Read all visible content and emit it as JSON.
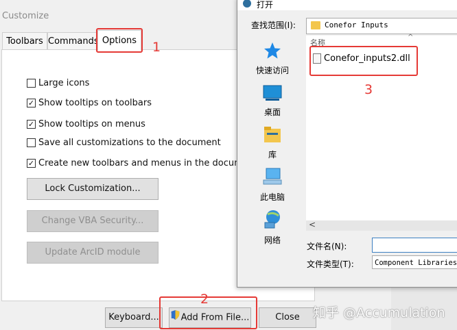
{
  "customize": {
    "title": "Customize",
    "tabs": [
      "Toolbars",
      "Commands",
      "Options"
    ],
    "checkboxes": [
      {
        "label": "Large icons",
        "checked": false
      },
      {
        "label": "Show tooltips on toolbars",
        "checked": true
      },
      {
        "label": "Show tooltips on menus",
        "checked": true
      },
      {
        "label": "Save all customizations to the document",
        "checked": false
      },
      {
        "label": "Create new toolbars and menus in the document",
        "checked": true
      }
    ],
    "buttons": {
      "lock": "Lock Customization...",
      "vba": "Change VBA Security...",
      "arcid": "Update ArcID module",
      "keyboard": "Keyboard...",
      "add_from_file": "Add From File...",
      "close": "Close"
    }
  },
  "annotations": {
    "one": "1",
    "two": "2",
    "three": "3"
  },
  "open_dialog": {
    "title": "打开",
    "look_in_label": "查找范围(I):",
    "look_in_value": "Conefor Inputs",
    "places": [
      "快速访问",
      "桌面",
      "库",
      "此电脑",
      "网络"
    ],
    "column_header": "名称",
    "file": "Conefor_inputs2.dll",
    "filename_label": "文件名(N):",
    "filename_value": "",
    "filetype_label": "文件类型(T):",
    "filetype_value": "Component Libraries"
  },
  "watermark": "知乎 @Accumulation",
  "colors": {
    "annotation": "#e53935",
    "accent": "#3c7fc1"
  }
}
